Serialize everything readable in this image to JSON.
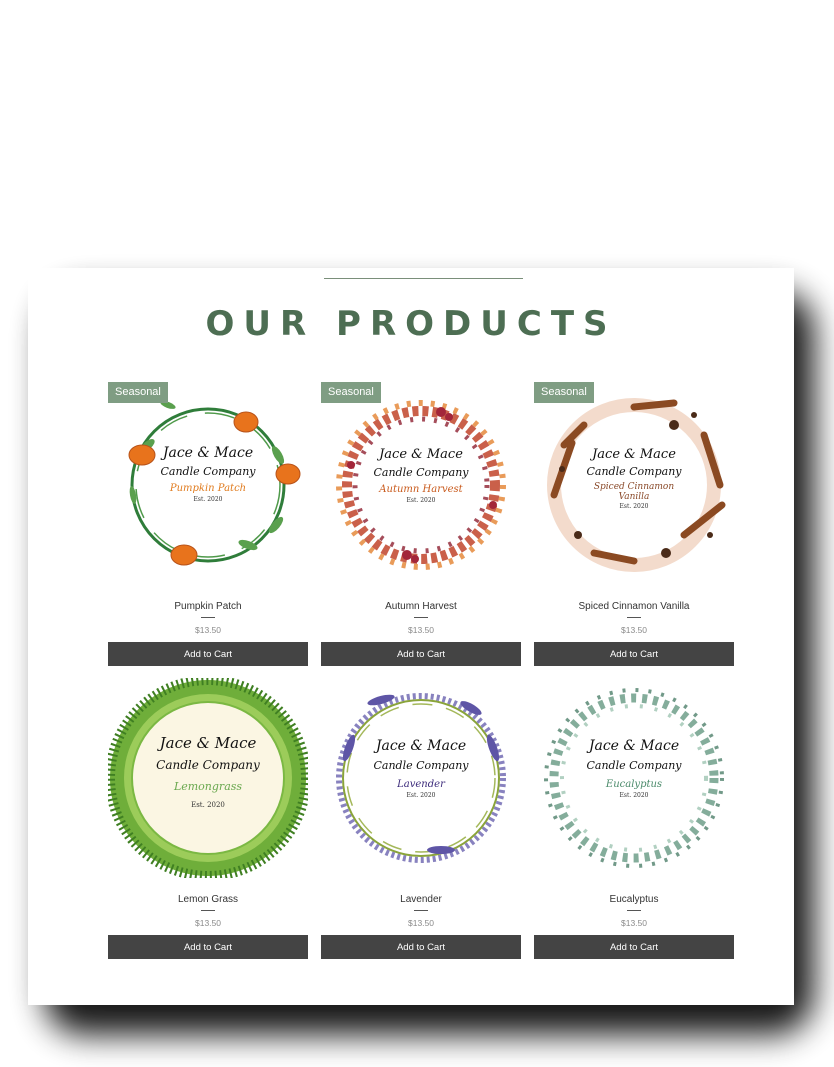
{
  "section": {
    "title": "OUR PRODUCTS"
  },
  "brand": {
    "line1": "Jace & Mace",
    "line2": "Candle Company",
    "est": "Est. 2020"
  },
  "products": [
    {
      "name": "Pumpkin Patch",
      "price": "$13.50",
      "badge": "Seasonal",
      "label": "Pumpkin Patch",
      "label2": "",
      "button": "Add to Cart",
      "accent": "#e07b1e",
      "wreath": "pumpkin"
    },
    {
      "name": "Autumn Harvest",
      "price": "$13.50",
      "badge": "Seasonal",
      "label": "Autumn Harvest",
      "label2": "",
      "button": "Add to Cart",
      "accent": "#c95a1c",
      "wreath": "autumn"
    },
    {
      "name": "Spiced Cinnamon Vanilla",
      "price": "$13.50",
      "badge": "Seasonal",
      "label": "Spiced Cinnamon",
      "label2": "Vanilla",
      "button": "Add to Cart",
      "accent": "#8a4a2a",
      "wreath": "cinnamon"
    },
    {
      "name": "Lemon Grass",
      "price": "$13.50",
      "badge": "",
      "label": "Lemongrass",
      "label2": "",
      "button": "Add to Cart",
      "accent": "#6aa84f",
      "wreath": "grass"
    },
    {
      "name": "Lavender",
      "price": "$13.50",
      "badge": "",
      "label": "Lavender",
      "label2": "",
      "button": "Add to Cart",
      "accent": "#3b2a7a",
      "wreath": "lavender"
    },
    {
      "name": "Eucalyptus",
      "price": "$13.50",
      "badge": "",
      "label": "Eucalyptus",
      "label2": "",
      "button": "Add to Cart",
      "accent": "#4a8a6a",
      "wreath": "eucalyptus"
    }
  ]
}
